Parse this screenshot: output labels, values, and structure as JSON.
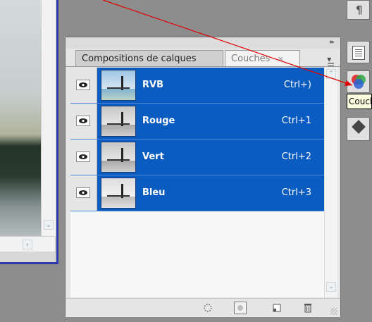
{
  "panel": {
    "tabs": [
      {
        "label": "Compositions de calques",
        "active": false
      },
      {
        "label": "Couches",
        "active": true,
        "close_glyph": "×"
      }
    ],
    "channels": [
      {
        "name": "RVB",
        "shortcut": "Ctrl+)",
        "visible": true,
        "selected": true,
        "thumbnail": "color-beach-thumbnail"
      },
      {
        "name": "Rouge",
        "shortcut": "Ctrl+1",
        "visible": true,
        "selected": true,
        "thumbnail": "grayscale-beach-thumbnail"
      },
      {
        "name": "Vert",
        "shortcut": "Ctrl+2",
        "visible": true,
        "selected": true,
        "thumbnail": "grayscale-beach-thumbnail"
      },
      {
        "name": "Bleu",
        "shortcut": "Ctrl+3",
        "visible": true,
        "selected": true,
        "thumbnail": "light-grayscale-beach-thumbnail"
      }
    ],
    "footer_buttons": [
      "load-channel-as-selection-icon",
      "save-selection-as-channel-icon",
      "new-channel-icon",
      "delete-channel-icon"
    ]
  },
  "dock": {
    "buttons": [
      "paragraph-icon",
      "notes-icon",
      "channels-icon",
      "layers-icon"
    ],
    "tooltip": "Couches"
  },
  "colors": {
    "selection": "#0b5cc0",
    "panel_bg": "#e5e5e5",
    "workspace": "#8d8d8d",
    "doc_border": "#2b3aa8",
    "annotation_arrow": "#e00000"
  }
}
